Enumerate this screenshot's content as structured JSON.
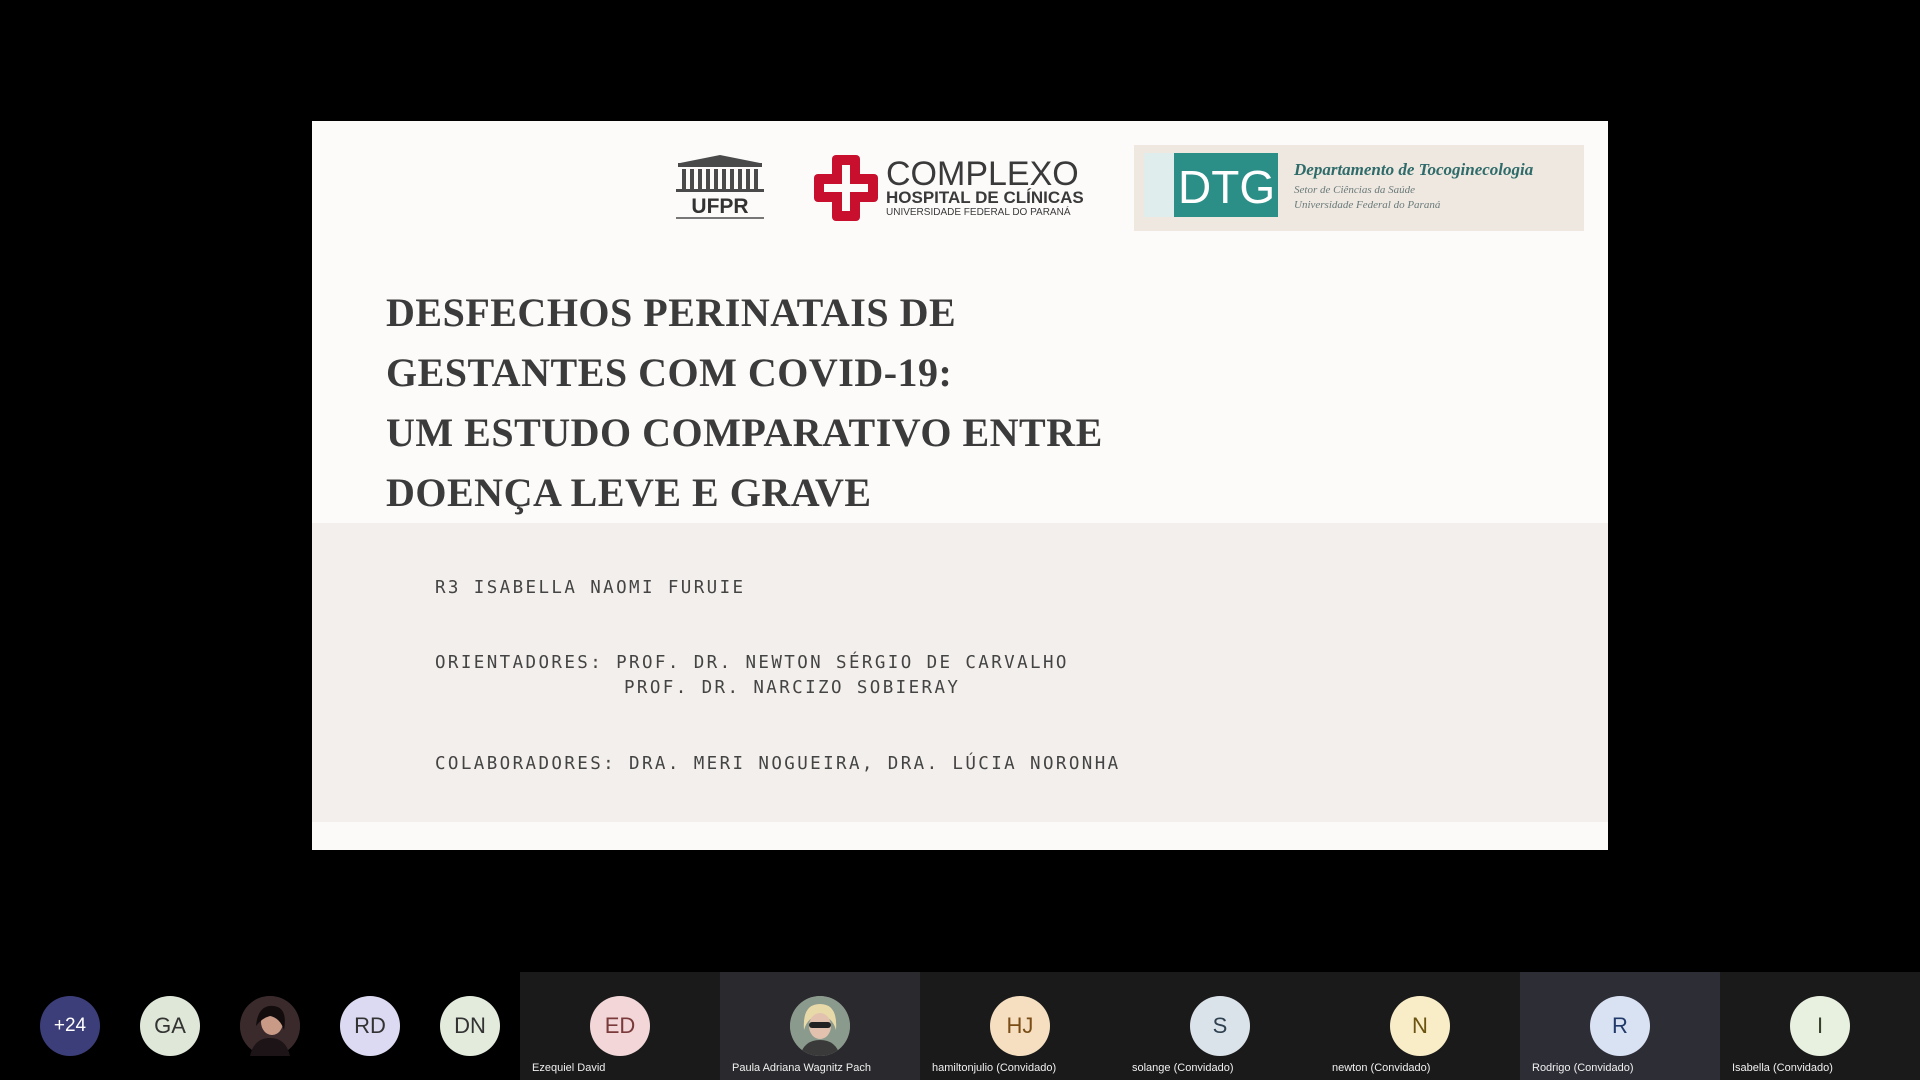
{
  "slide": {
    "logos": {
      "ufpr": "UFPR",
      "hc_main": "COMPLEXO",
      "hc_sub": "HOSPITAL DE CLÍNICAS",
      "hc_univ": "UNIVERSIDADE FEDERAL DO PARANÁ",
      "dtg_abbr": "DTG",
      "dtg_name": "Departamento de Tocoginecologia",
      "dtg_sector": "Setor de Ciências da Saúde",
      "dtg_univ": "Universidade Federal do Paraná"
    },
    "title_lines": [
      "DESFECHOS PERINATAIS DE",
      "GESTANTES COM COVID-19:",
      "UM ESTUDO COMPARATIVO ENTRE",
      "DOENÇA LEVE E GRAVE"
    ],
    "author": "R3 ISABELLA NAOMI FURUIE",
    "advisors_line1": "ORIENTADORES: PROF. DR. NEWTON SÉRGIO DE CARVALHO",
    "advisors_line2": "PROF. DR. NARCIZO SOBIERAY",
    "collaborators": "COLABORADORES: DRA. MERI NOGUEIRA, DRA. LÚCIA NORONHA"
  },
  "participants": {
    "overflow_count": "+24",
    "chips": [
      {
        "initials": "GA",
        "bg": "#dfe8d8"
      },
      {
        "photo": "avatar-photo"
      },
      {
        "initials": "RD",
        "bg": "#dcdaf2"
      },
      {
        "initials": "DN",
        "bg": "#e2ebdc"
      }
    ],
    "tiles": [
      {
        "initials": "ED",
        "name": "Ezequiel David",
        "bg": "#f2d6d8",
        "color": "#7a3a3a",
        "tile_bg": "#1a1a1a"
      },
      {
        "photo": "avatar-photo",
        "name": "Paula Adriana Wagnitz Pach",
        "tile_bg": "#2a2a2e"
      },
      {
        "initials": "HJ",
        "name": "hamiltonjulio (Convidado)",
        "bg": "#f6dfc0",
        "color": "#7a4d16",
        "tile_bg": "#1a1a1a"
      },
      {
        "initials": "S",
        "name": "solange (Convidado)",
        "bg": "#dbe3ea",
        "color": "#2f4150",
        "tile_bg": "#1a1a1a"
      },
      {
        "initials": "N",
        "name": "newton (Convidado)",
        "bg": "#f9edc8",
        "color": "#6b5310",
        "tile_bg": "#1a1a1a"
      },
      {
        "initials": "R",
        "name": "Rodrigo (Convidado)",
        "bg": "#d9e2f3",
        "color": "#223a6a",
        "tile_bg": "#2d2d36"
      },
      {
        "initials": "I",
        "name": "Isabella (Convidado)",
        "bg": "#e8f0e0",
        "color": "#35402a",
        "tile_bg": "#1a1a1a"
      }
    ]
  },
  "colors": {
    "background": "#000000",
    "slide": "#fcfbfa",
    "slide_lower": "#f3efec",
    "title_text": "#3b3b3b",
    "hc_red": "#c8102e",
    "dtg_teal": "#2b8f88",
    "overflow_chip": "#3c3e7a"
  }
}
